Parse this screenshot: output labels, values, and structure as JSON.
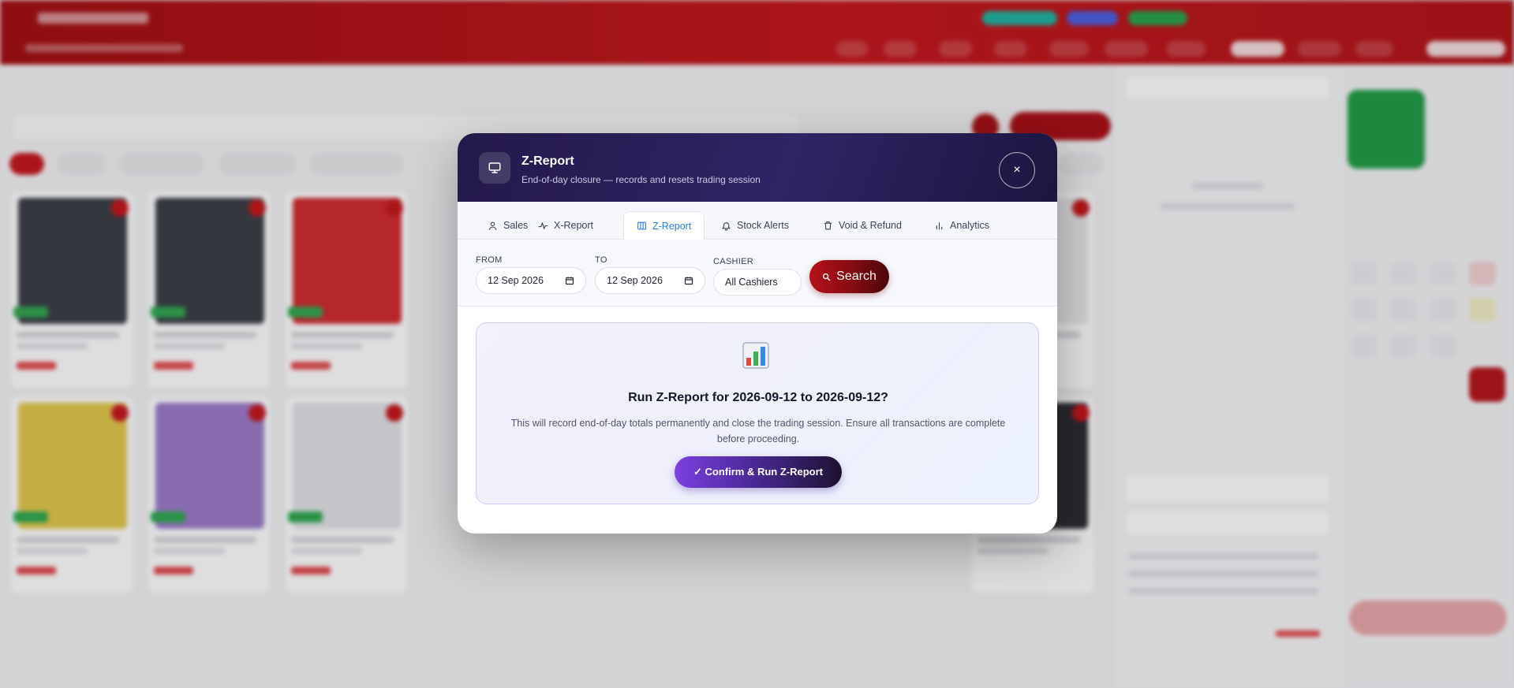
{
  "modal": {
    "title": "Z-Report",
    "subtitle": "End-of-day closure — records and resets trading session",
    "close_symbol": "×",
    "header_icon": "monitor-icon"
  },
  "tabs": [
    {
      "label": "Sales",
      "icon": "user-icon",
      "active": false
    },
    {
      "label": "X-Report",
      "icon": "activity-icon",
      "active": false
    },
    {
      "label": "Z-Report",
      "icon": "columns-icon",
      "active": true
    },
    {
      "label": "Stock Alerts",
      "icon": "bell-icon",
      "active": false
    },
    {
      "label": "Void & Refund",
      "icon": "trash-icon",
      "active": false
    },
    {
      "label": "Analytics",
      "icon": "bar-chart-icon",
      "active": false
    }
  ],
  "filters": {
    "from_label": "FROM",
    "from_value": "12 Sep 2026",
    "to_label": "TO",
    "to_value": "12 Sep 2026",
    "cashier_label": "CASHIER",
    "cashier_value": "All Cashiers",
    "search_label": "Search"
  },
  "confirm_panel": {
    "icon": "bar-chart-emoji-icon",
    "title": "Run Z-Report for 2026-09-12 to 2026-09-12?",
    "description": "This will record end-of-day totals permanently and close the trading session. Ensure all transactions are complete before proceeding.",
    "button_label": "✓ Confirm & Run Z-Report"
  },
  "colors": {
    "header_bg": "#2f2464",
    "active_tab": "#2a7de1",
    "search_button": "#8a0c12",
    "confirm_button": "#7d3fe0",
    "app_brand_red": "#c4161a"
  }
}
